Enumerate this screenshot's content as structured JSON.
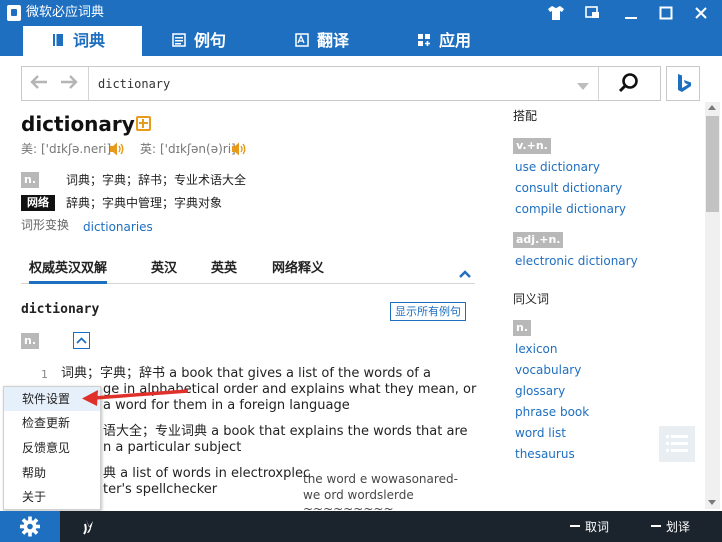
{
  "window": {
    "title": "微软必应词典",
    "buttons": [
      "shirt-icon",
      "mini-window-icon",
      "minimize-icon",
      "maximize-icon",
      "close-icon"
    ]
  },
  "tabs": [
    {
      "label": "词典",
      "icon": "book-icon",
      "active": true
    },
    {
      "label": "例句",
      "icon": "list-icon",
      "active": false
    },
    {
      "label": "翻译",
      "icon": "translate-icon",
      "active": false
    },
    {
      "label": "应用",
      "icon": "apps-icon",
      "active": false
    }
  ],
  "search": {
    "value": "dictionary"
  },
  "entry": {
    "word": "dictionary",
    "phonetic_us_label": "美:",
    "phonetic_us": "['dɪkʃə.neri]",
    "phonetic_uk_label": "英:",
    "phonetic_uk": "['dɪkʃən(ə)ri]",
    "pos_n": "n.",
    "def_n": "词典；字典；辞书；专业术语大全",
    "web_label": "网络",
    "def_web": "辞典；字典中管理；字典对象",
    "forms_label": "词形变换",
    "forms_value": "dictionaries"
  },
  "subtabs": [
    "权威英汉双解",
    "英汉",
    "英英",
    "网络释义"
  ],
  "detail": {
    "headword": "dictionary",
    "show_all": "显示所有例句",
    "pos": "n.",
    "senses": [
      {
        "num": "1",
        "line1": "词典；字典；辞书 a book that gives a list of the words of a",
        "line2": "ge in alphabetical order and explains what they mean, or",
        "line3": "a word for them in a foreign language"
      },
      {
        "num": "",
        "line1": "语大全；专业词典 a book that explains the words that are",
        "line2": "n a particular subject"
      },
      {
        "num": "",
        "line1": "典 a list of words in electroxplec",
        "line2": "ter's spellchecker"
      }
    ],
    "ghost_lines": [
      "the word   e wowasonared-",
      "we  ord wordslerde",
      "    ~~~~~~~~~"
    ]
  },
  "collocations": {
    "title": "搭配",
    "groups": [
      {
        "pos": "v.+n.",
        "items": [
          "use dictionary",
          "consult dictionary",
          "compile dictionary"
        ]
      },
      {
        "pos": "adj.+n.",
        "items": [
          "electronic dictionary"
        ]
      }
    ]
  },
  "synonyms": {
    "title": "同义词",
    "pos": "n.",
    "items": [
      "lexicon",
      "vocabulary",
      "glossary",
      "phrase book",
      "word list",
      "thesaurus"
    ]
  },
  "context_menu": {
    "items": [
      "软件设置",
      "检查更新",
      "反馈意见",
      "帮助",
      "关于"
    ],
    "highlighted_index": 0
  },
  "bottom": {
    "lookup_toggle": "取词",
    "translate_toggle": "划译"
  },
  "colors": {
    "brand": "#1e6fc0",
    "bottom_bar": "#1b232d",
    "link": "#1e6fc0",
    "speaker": "#e89a1a",
    "arrow": "#e0302a"
  }
}
